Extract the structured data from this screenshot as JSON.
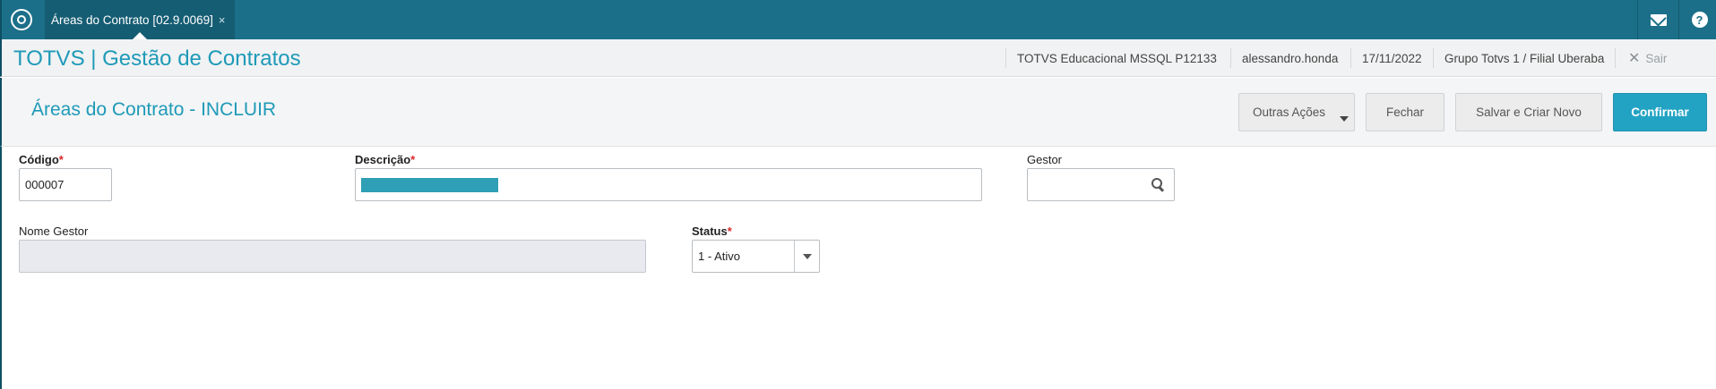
{
  "topbar": {
    "logo_icon": "totvs-logo-icon",
    "tab": {
      "title": "Áreas do Contrato [02.9.0069]",
      "close": "×"
    },
    "mail_icon": "mail-icon",
    "help_icon": "help-icon",
    "help_glyph": "?"
  },
  "header": {
    "app_title": "TOTVS | Gestão de Contratos",
    "server": "TOTVS Educacional MSSQL P12133",
    "user": "alessandro.honda",
    "date": "17/11/2022",
    "company": "Grupo Totvs 1 / Filial Uberaba",
    "logout_label": "Sair",
    "logout_glyph": "✕"
  },
  "page": {
    "title": "Áreas do Contrato - INCLUIR",
    "actions": {
      "other": "Outras Ações",
      "close": "Fechar",
      "save_new": "Salvar e Criar Novo",
      "confirm": "Confirmar"
    }
  },
  "form": {
    "codigo": {
      "label": "Código",
      "required_mark": "*",
      "value": "000007"
    },
    "descricao": {
      "label": "Descrição",
      "required_mark": "*",
      "value": ""
    },
    "gestor": {
      "label": "Gestor",
      "value": ""
    },
    "nome_gestor": {
      "label": "Nome Gestor",
      "value": ""
    },
    "status": {
      "label": "Status",
      "required_mark": "*",
      "value": "1 - Ativo"
    }
  },
  "colors": {
    "topbar": "#1b6f89",
    "accent": "#1e9ab8",
    "confirm_button": "#23a3c4",
    "required": "#d62a2a"
  }
}
